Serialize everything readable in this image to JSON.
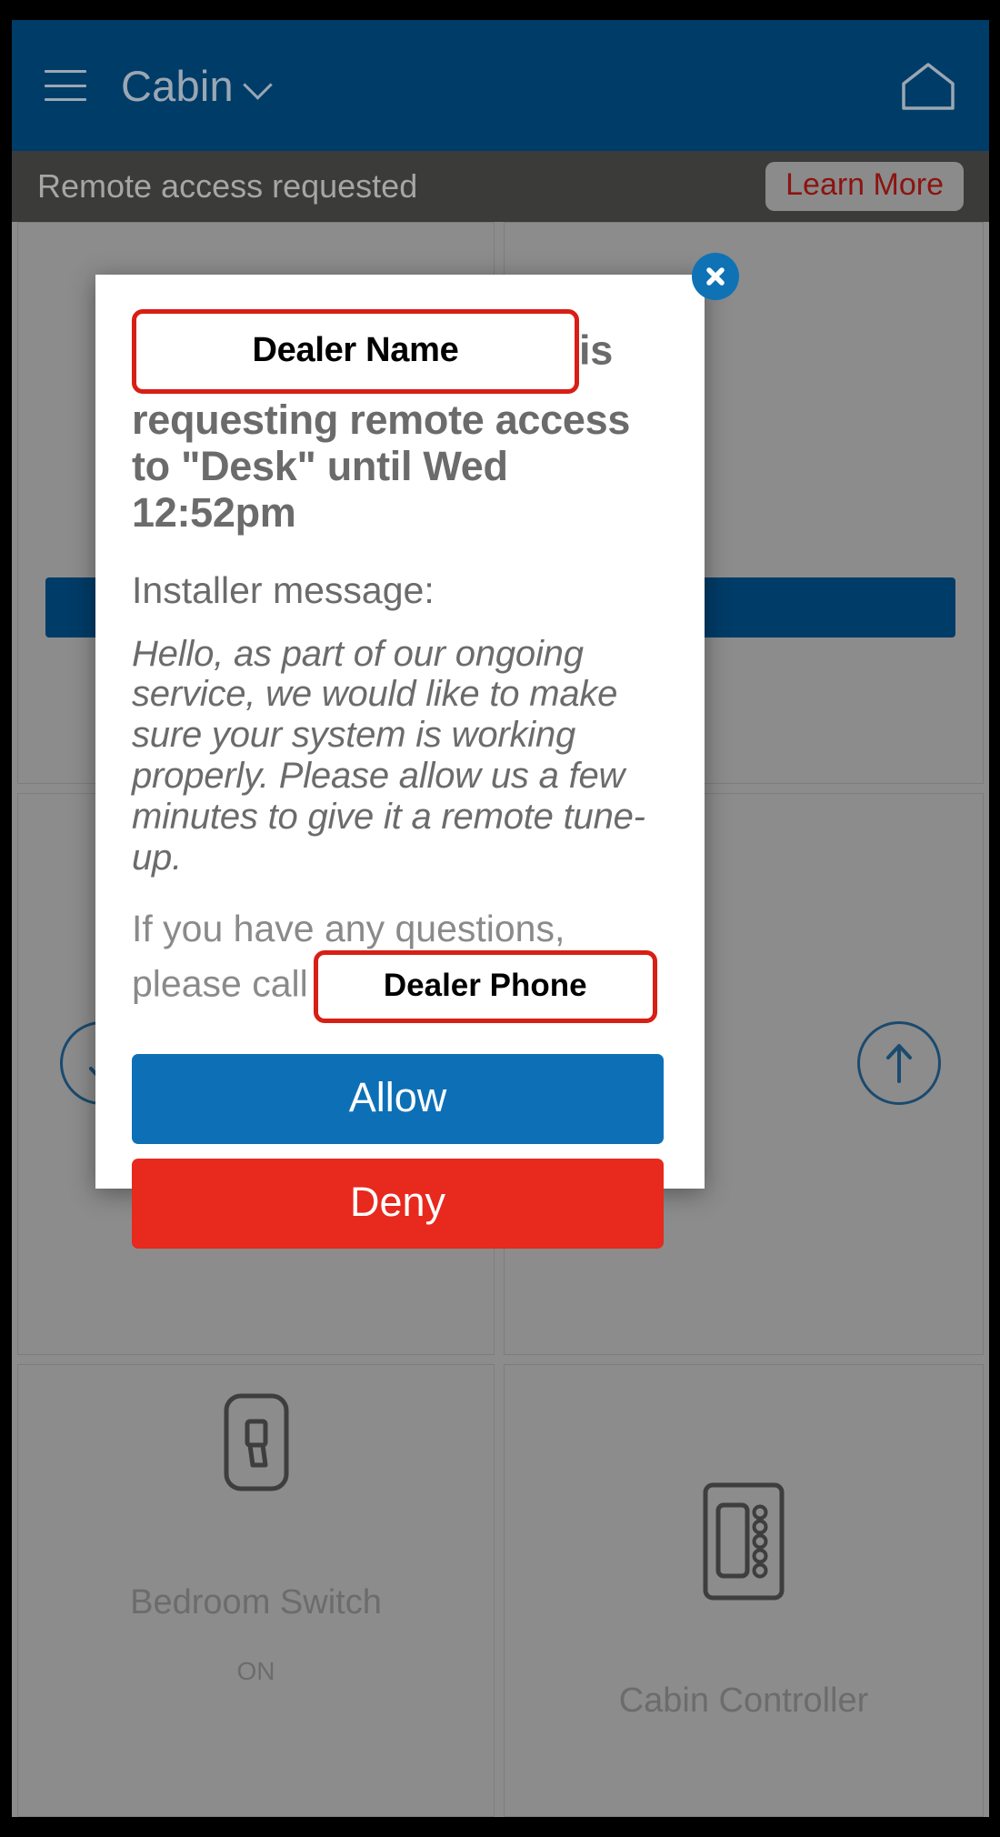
{
  "topbar": {
    "menu_icon": "hamburger-menu-icon",
    "location_name": "Cabin",
    "dropdown_icon": "chevron-down-icon",
    "home_icon": "home-icon"
  },
  "banner": {
    "message": "Remote access requested",
    "learn_more_label": "Learn More"
  },
  "background_tiles": [
    {
      "title": "",
      "state": ""
    },
    {
      "title": "",
      "state": ""
    },
    {
      "title": "",
      "state": ""
    },
    {
      "title": "",
      "state": ""
    },
    {
      "title": "Bedroom Switch",
      "state": "ON",
      "icon": "light-switch-icon"
    },
    {
      "title": "Cabin Controller",
      "state": "",
      "icon": "controller-keypad-icon"
    }
  ],
  "modal": {
    "close_icon": "close-x-icon",
    "dealer_name_placeholder": "Dealer Name",
    "heading_suffix": "is requesting remote access to \"Desk\" until Wed 12:52pm",
    "installer_label": "Installer message:",
    "installer_message": "Hello, as part of our ongoing service, we would like to make sure your system is working properly. Please allow us a few minutes to give it a remote tune-up.",
    "questions_prefix": "If you have any questions, please call",
    "dealer_phone_placeholder": "Dealer Phone",
    "allow_label": "Allow",
    "deny_label": "Deny"
  },
  "colors": {
    "header_blue": "#003c68",
    "banner_gray": "#3b3b3a",
    "learn_more_red": "#8b1410",
    "redaction_red": "#d81f15",
    "allow_blue": "#0d70b7",
    "deny_red": "#e7291e",
    "close_blue": "#0f72b5"
  }
}
